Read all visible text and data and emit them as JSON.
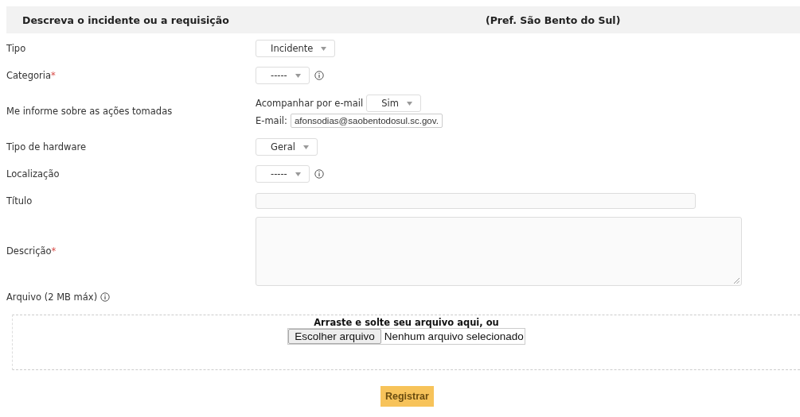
{
  "header": {
    "title": "Descreva o incidente ou a requisição",
    "subtitle": "(Pref. São Bento do Sul)"
  },
  "fields": [
    {
      "kind": "select",
      "label": "Tipo",
      "value": "Incidente"
    },
    {
      "kind": "select",
      "label": "Categoria",
      "mark": "*",
      "value": "-----",
      "info": true
    },
    {
      "kind": "email",
      "label": "Me informe sobre as ações tomadas",
      "follow_label": "Acompanhar por e-mail",
      "follow_value": "Sim",
      "email_label": "E-mail:",
      "email_value": "afonsodias@saobentodosul.sc.gov."
    },
    {
      "kind": "select",
      "label": "Tipo de hardware",
      "value": "Geral"
    },
    {
      "kind": "select",
      "label": "Localização",
      "value": "-----",
      "info": true
    },
    {
      "kind": "text",
      "label": "Título"
    },
    {
      "kind": "textarea",
      "label": "Descrição",
      "mark": "*"
    }
  ],
  "attachment": {
    "label": "Arquivo (2 MB máx)",
    "info": true,
    "drop_text": "Arraste e solte seu arquivo aqui, ou",
    "choose_button": "Escolher arquivo",
    "file_status": "Nenhum arquivo selecionado"
  },
  "submit": "Registrar"
}
